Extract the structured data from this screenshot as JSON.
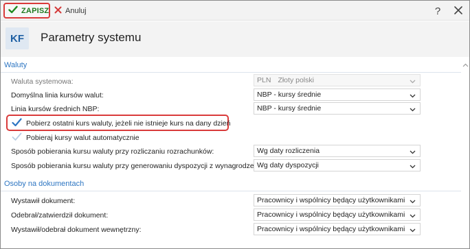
{
  "toolbar": {
    "save_label": "ZAPISZ",
    "cancel_label": "Anuluj",
    "help_label": "?"
  },
  "header": {
    "badge": "KF",
    "title": "Parametry systemu"
  },
  "sections": {
    "waluty": "Waluty",
    "osoby": "Osoby na dokumentach"
  },
  "fields": {
    "waluta_systemowa": {
      "label": "Waluta systemowa:",
      "code": "PLN",
      "value": "Złoty polski"
    },
    "domyslna_linia": {
      "label": "Domyślna linia kursów walut:",
      "value": "NBP - kursy średnie"
    },
    "linia_srednich": {
      "label": "Linia kursów średnich NBP:",
      "value": "NBP - kursy średnie"
    },
    "pobierz_ostatni": {
      "label": "Pobierz ostatni kurs waluty, jeżeli nie istnieje kurs na dany dzień",
      "checked": true
    },
    "pobieraj_auto": {
      "label": "Pobieraj kursy walut automatycznie",
      "checked": true
    },
    "sposob_rozrachunki": {
      "label": "Sposób pobierania kursu waluty przy rozliczaniu rozrachunków:",
      "value": "Wg daty rozliczenia"
    },
    "sposob_dyspozycje": {
      "label": "Sposób pobierania kursu waluty przy generowaniu dyspozycji z wynagrodzeń:",
      "value": "Wg daty dyspozycji"
    },
    "wystawil": {
      "label": "Wystawił dokument:",
      "value": "Pracownicy i wspólnicy będący użytkownikami"
    },
    "odebral": {
      "label": "Odebrał/zatwierdził dokument:",
      "value": "Pracownicy i wspólnicy będący użytkownikami"
    },
    "wystawil_wewn": {
      "label": "Wystawił/odebrał dokument wewnętrzny:",
      "value": "Pracownicy i wspólnicy będący użytkownikami"
    }
  },
  "colors": {
    "accent_blue": "#2e76c2",
    "save_green": "#1f7a1f",
    "highlight_red": "#d93a3a",
    "cancel_red": "#d43a3a"
  },
  "icons": [
    "check-icon",
    "close-x-icon",
    "help-icon",
    "window-close-icon",
    "chevron-down-icon",
    "chevron-up-icon",
    "checkbox-check-icon"
  ]
}
